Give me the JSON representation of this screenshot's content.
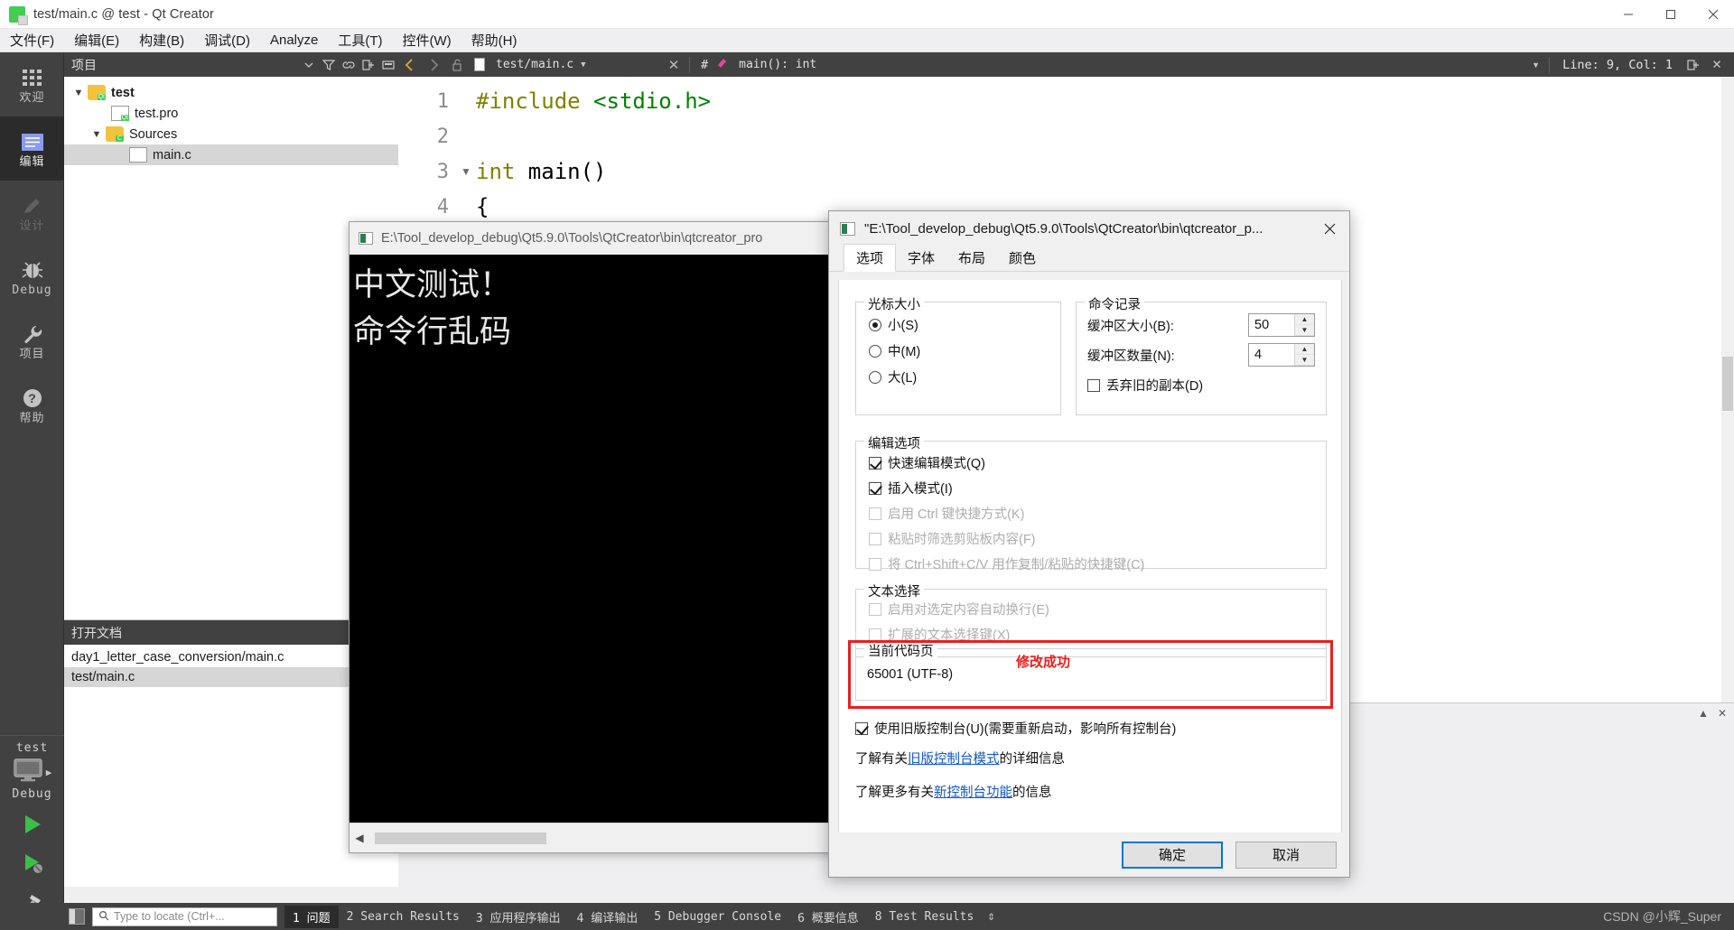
{
  "window": {
    "title": "test/main.c @ test - Qt Creator",
    "app_icon": "qt-logo-icon",
    "controls": {
      "minimize": "minimize-icon",
      "maximize": "maximize-icon",
      "close": "close-icon"
    }
  },
  "menubar": [
    {
      "label": "文件(F)",
      "mnemonic": "F"
    },
    {
      "label": "编辑(E)",
      "mnemonic": "E"
    },
    {
      "label": "构建(B)",
      "mnemonic": "B"
    },
    {
      "label": "调试(D)",
      "mnemonic": "D"
    },
    {
      "label": "Analyze",
      "mnemonic": "A"
    },
    {
      "label": "工具(T)",
      "mnemonic": "T"
    },
    {
      "label": "控件(W)",
      "mnemonic": "W"
    },
    {
      "label": "帮助(H)",
      "mnemonic": "H"
    }
  ],
  "modebar": {
    "items": [
      {
        "label": "欢迎",
        "icon": "grid-icon",
        "state": "normal"
      },
      {
        "label": "编辑",
        "icon": "document-lines-icon",
        "state": "active"
      },
      {
        "label": "设计",
        "icon": "pencil-icon",
        "state": "disabled"
      },
      {
        "label": "Debug",
        "icon": "bug-icon",
        "state": "normal"
      },
      {
        "label": "项目",
        "icon": "wrench-icon",
        "state": "normal"
      },
      {
        "label": "帮助",
        "icon": "question-circle-icon",
        "state": "normal"
      }
    ],
    "kit": {
      "name": "test",
      "build_config": "Debug",
      "target_icon": "monitor-icon",
      "run_icon": "run-triangle-icon",
      "debug_icon": "debug-triangle-icon",
      "build_icon": "hammer-icon"
    }
  },
  "project_pane": {
    "header_title": "项目",
    "header_icons": [
      "chevron-down-icon",
      "filter-icon",
      "link-icon",
      "split-icon",
      "minimize-pane-icon"
    ],
    "tree": [
      {
        "label": "test",
        "depth": 0,
        "icon": "qt-project-folder-icon",
        "expanded": true,
        "bold": true,
        "selected": false
      },
      {
        "label": "test.pro",
        "depth": 1,
        "icon": "qt-pro-file-icon",
        "expanded": null,
        "bold": false,
        "selected": false
      },
      {
        "label": "Sources",
        "depth": 1,
        "icon": "c-folder-icon",
        "expanded": true,
        "bold": false,
        "selected": false
      },
      {
        "label": "main.c",
        "depth": 2,
        "icon": "c-file-icon",
        "expanded": null,
        "bold": false,
        "selected": true
      }
    ]
  },
  "open_documents": {
    "header_title": "打开文档",
    "items": [
      {
        "label": "day1_letter_case_conversion/main.c",
        "selected": false
      },
      {
        "label": "test/main.c",
        "selected": true
      }
    ]
  },
  "editor_toolbar": {
    "file_combo": "test/main.c",
    "close_icon": "close-icon",
    "symbol_prefix": "#",
    "symbol_combo": "main(): int",
    "line_col": "Line: 9, Col: 1",
    "split_icon": "split-editor-icon",
    "back_icon": "back-arrow-icon",
    "forward_icon": "forward-arrow-icon",
    "lock_icon": "unlocked-icon",
    "file_icon": "file-icon"
  },
  "editor": {
    "lines": [
      {
        "number": "1",
        "fold": "",
        "tokens": [
          {
            "t": "#include",
            "c": "pp"
          },
          {
            "t": " ",
            "c": "plain"
          },
          {
            "t": "<stdio.h>",
            "c": "str"
          }
        ]
      },
      {
        "number": "2",
        "fold": "",
        "tokens": []
      },
      {
        "number": "3",
        "fold": "chevron-down-icon",
        "tokens": [
          {
            "t": "int",
            "c": "kw"
          },
          {
            "t": " main()",
            "c": "plain"
          }
        ]
      },
      {
        "number": "4",
        "fold": "",
        "tokens": [
          {
            "t": "{",
            "c": "plain"
          }
        ]
      }
    ]
  },
  "console_window": {
    "title": "E:\\Tool_develop_debug\\Qt5.9.0\\Tools\\QtCreator\\bin\\qtcreator_pro",
    "icon": "console-icon",
    "output_lines": [
      "中文测试！",
      "命令行乱码"
    ],
    "hscroll_left_icon": "chevron-left-icon",
    "hscroll_right_icon": "chevron-right-icon"
  },
  "dialog": {
    "title": "\"E:\\Tool_develop_debug\\Qt5.9.0\\Tools\\QtCreator\\bin\\qtcreator_p...",
    "icon": "console-icon",
    "close_icon": "close-icon",
    "tabs": [
      {
        "label": "选项",
        "active": true
      },
      {
        "label": "字体",
        "active": false
      },
      {
        "label": "布局",
        "active": false
      },
      {
        "label": "颜色",
        "active": false
      }
    ],
    "cursor_size": {
      "legend": "光标大小",
      "options": [
        {
          "label": "小(S)",
          "checked": true
        },
        {
          "label": "中(M)",
          "checked": false
        },
        {
          "label": "大(L)",
          "checked": false
        }
      ]
    },
    "command_history": {
      "legend": "命令记录",
      "buffer_size_label": "缓冲区大小(B):",
      "buffer_size_value": "50",
      "buffer_count_label": "缓冲区数量(N):",
      "buffer_count_value": "4",
      "discard_duplicates_label": "丢弃旧的副本(D)",
      "discard_duplicates_checked": false
    },
    "edit_options": {
      "legend": "编辑选项",
      "items": [
        {
          "label": "快速编辑模式(Q)",
          "checked": true,
          "enabled": true
        },
        {
          "label": "插入模式(I)",
          "checked": true,
          "enabled": true
        },
        {
          "label": "启用 Ctrl 键快捷方式(K)",
          "checked": false,
          "enabled": false
        },
        {
          "label": "粘贴时筛选剪贴板内容(F)",
          "checked": false,
          "enabled": false
        },
        {
          "label": "将 Ctrl+Shift+C/V 用作复制/粘贴的快捷键(C)",
          "checked": false,
          "enabled": false
        }
      ]
    },
    "text_selection": {
      "legend": "文本选择",
      "items": [
        {
          "label": "启用对选定内容自动换行(E)",
          "checked": false,
          "enabled": false
        },
        {
          "label": "扩展的文本选择键(X)",
          "checked": false,
          "enabled": false
        }
      ]
    },
    "codepage": {
      "legend": "当前代码页",
      "value": "65001 (UTF-8)",
      "annotation": "修改成功",
      "annotation_color": "#ee1c1c",
      "highlight_color": "#ee1c1c"
    },
    "legacy_console": {
      "checkbox_label": "使用旧版控制台(U)(需要重新启动，影响所有控制台)",
      "checkbox_checked": true,
      "link_line1_prefix": "了解有关",
      "link_line1_link": "旧版控制台模式",
      "link_line1_suffix": "的详细信息",
      "link_line2_prefix": "了解更多有关",
      "link_line2_link": "新控制台功能",
      "link_line2_suffix": "的信息",
      "link_color": "#1155cc"
    },
    "buttons": {
      "ok": "确定",
      "cancel": "取消"
    }
  },
  "statusbar": {
    "toggle_sidebar_icon": "toggle-sidebar-icon",
    "locator_placeholder": "Type to locate (Ctrl+...",
    "locator_icon": "search-icon",
    "items": [
      {
        "label": "1 问题",
        "active": true
      },
      {
        "label": "2 Search Results",
        "active": false
      },
      {
        "label": "3 应用程序输出",
        "active": false
      },
      {
        "label": "4 编译输出",
        "active": false
      },
      {
        "label": "5 Debugger Console",
        "active": false
      },
      {
        "label": "6 概要信息",
        "active": false
      },
      {
        "label": "8 Test Results",
        "active": false
      }
    ],
    "updown_icon": "up-down-arrows-icon",
    "watermark": "CSDN @小辉_Super"
  }
}
